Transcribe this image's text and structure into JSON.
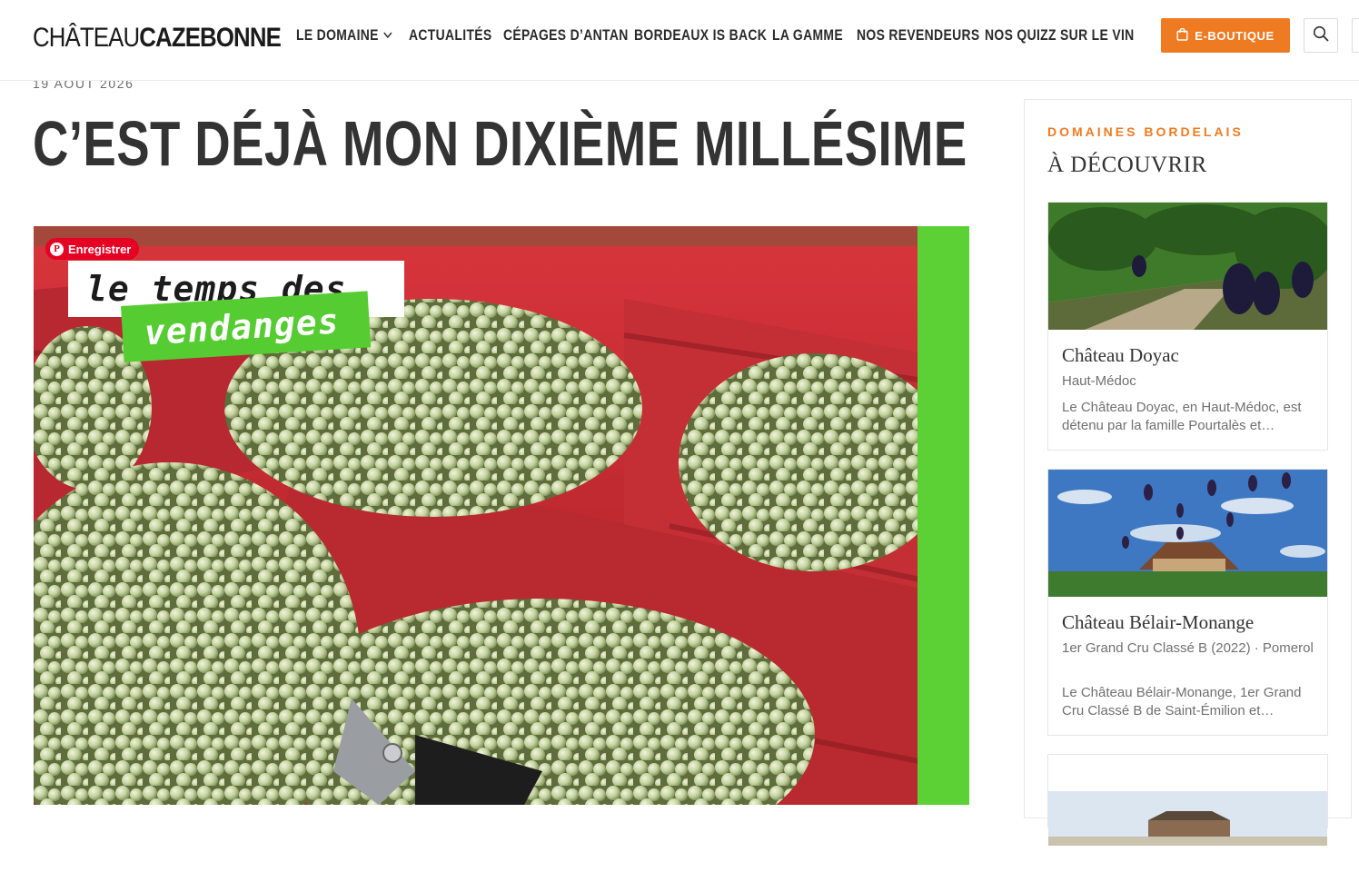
{
  "header": {
    "logo_light": "CHÂTEAU",
    "logo_bold": "CAZEBONNE",
    "nav": [
      {
        "label": "Le Domaine",
        "has_dropdown": true
      },
      {
        "label": "Actualités",
        "has_dropdown": false
      },
      {
        "label": "Cépages d’antan",
        "has_dropdown": false
      },
      {
        "label": "Bordeaux is back",
        "has_dropdown": false
      },
      {
        "label": "La Gamme",
        "has_dropdown": false
      },
      {
        "label": "Nos revendeurs",
        "has_dropdown": false
      },
      {
        "label": "Nos Quizz sur le vin",
        "has_dropdown": false
      }
    ],
    "eboutique_label": "E-BOUTIQUE",
    "eboutique_icon": "shopping-bag-icon",
    "search_icon": "search-icon",
    "accent_color": "#ee7b22"
  },
  "article": {
    "date": "19 AOÛT 2026",
    "title": "C’EST DÉJÀ MON DIXIÈME MILLÉSIME",
    "image": {
      "pin_label": "Enregistrer",
      "pin_icon": "pinterest-icon",
      "overlay_line1": "le temps des",
      "overlay_line2": "vendanges",
      "green_color": "#5bd136"
    }
  },
  "sidebar": {
    "kicker": "DOMAINES BORDELAIS",
    "heading": "À DÉCOUVRIR",
    "cards": [
      {
        "title": "Château Doyac",
        "subtitle": "Haut-Médoc",
        "description": "Le Château Doyac, en Haut-Médoc, est détenu par la famille Pourtalès et…"
      },
      {
        "title": "Château Bélair-Monange",
        "subtitle": "1er Grand Cru Classé B (2022) · Pomerol",
        "description": "Le Château Bélair-Monange, 1er Grand Cru Classé B de Saint-Émilion et…"
      },
      {
        "title": "",
        "subtitle": "",
        "description": ""
      }
    ]
  }
}
